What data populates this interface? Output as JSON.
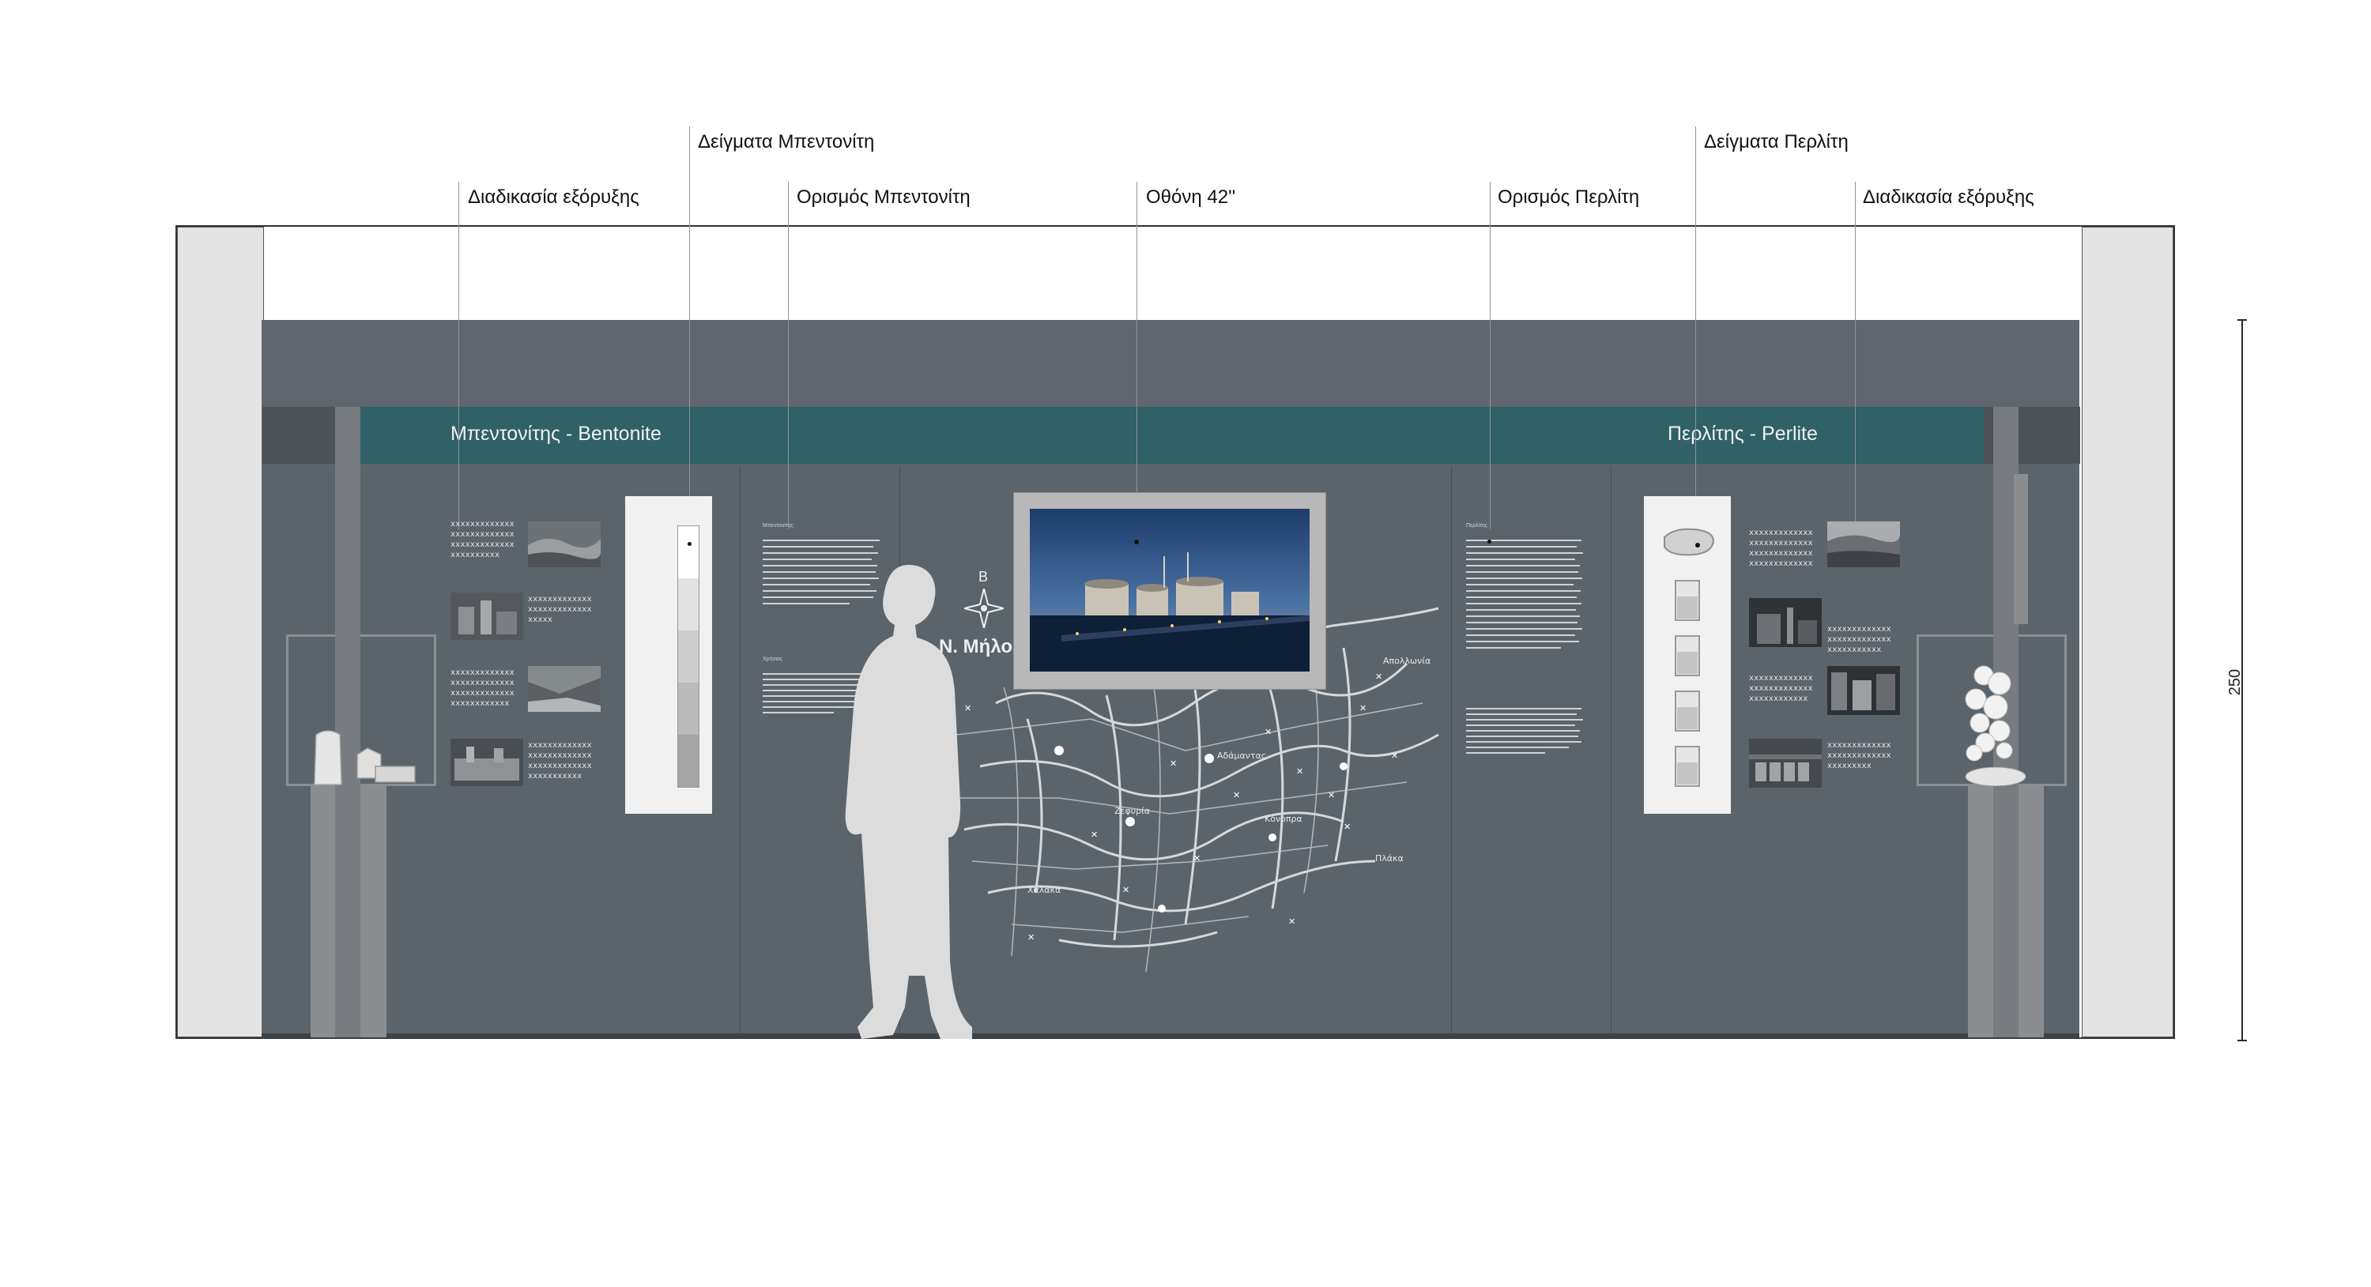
{
  "labels": {
    "extraction_left": "Διαδικασία εξόρυξης",
    "samples_bentonite": "Δείγματα Μπεντονίτη",
    "definition_bentonite": "Ορισμός Μπεντονίτη",
    "screen": "Οθόνη 42''",
    "definition_perlite": "Ορισμός Περλίτη",
    "samples_perlite": "Δείγματα Περλίτη",
    "extraction_right": "Διαδικασία εξόρυξης"
  },
  "header": {
    "left_title": "Μπεντονίτης - Bentonite",
    "right_title": "Περλίτης - Perlite"
  },
  "placeholder_text": {
    "left_block_1": "xxxxxxxxxxxxx\nxxxxxxxxxxxxx\nxxxxxxxxxxxxx\nxxxxxxxxxx",
    "left_block_2": "xxxxxxxxxxxxx\nxxxxxxxxxxxxx\nxxxxx",
    "left_block_3": "xxxxxxxxxxxxx\nxxxxxxxxxxxxx\nxxxxxxxxxxxxx\nxxxxxxxxxxxx",
    "left_block_4": "xxxxxxxxxxxxx\nxxxxxxxxxxxxx\nxxxxxxxxxxxxx\nxxxxxxxxxxx",
    "right_block_1": "xxxxxxxxxxxxx\nxxxxxxxxxxxxx\nxxxxxxxxxxxxx\nxxxxxxxxxxxxx",
    "right_block_2": "xxxxxxxxxxxxx\nxxxxxxxxxxxxx\nxxxxxxxxxxx",
    "right_block_3": "xxxxxxxxxxxxx\nxxxxxxxxxxxxx\nxxxxxxxxxxxx",
    "right_block_4": "xxxxxxxxxxxxx\nxxxxxxxxxxxxx\nxxxxxxxxx"
  },
  "map": {
    "island_label": "Ν. Μήλος",
    "north_label": "Β",
    "places": [
      "Απολλωνία",
      "Αδάμαντας",
      "Κόνοπρα",
      "Ζεφυρία",
      "Χάλακα",
      "Πλάκα"
    ]
  },
  "dimension": {
    "height": "250"
  },
  "colors": {
    "wall": "#5c646b",
    "header_band": "#2f6167",
    "pillar": "#e3e3e3",
    "silhouette": "#dcdcdc"
  }
}
